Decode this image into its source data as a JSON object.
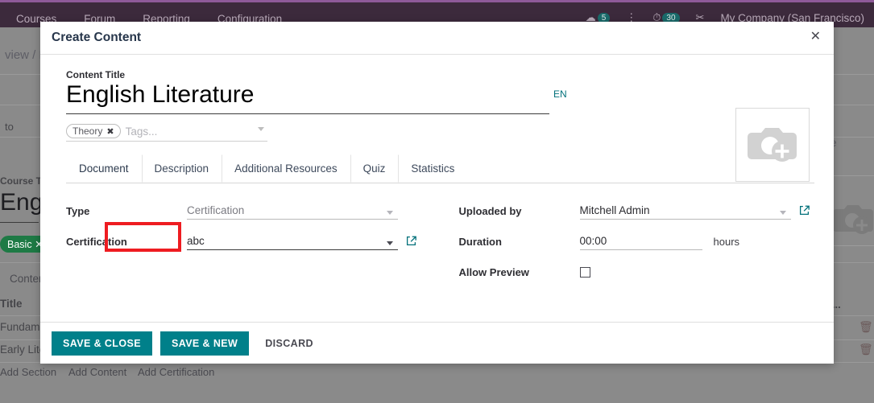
{
  "background": {
    "topnav": {
      "items": [
        "Courses",
        "Forum",
        "Reporting",
        "Configuration"
      ],
      "badges": [
        {
          "icon": "message-icon",
          "count": "5"
        },
        {
          "icon": "clock-icon",
          "count": "30"
        }
      ],
      "activity_icon": "activities-icon",
      "scissors_icon": "scissors-icon",
      "company": "My Company (San Francisco)"
    },
    "breadcrumb": "view / N",
    "go_to_website": {
      "line1": "to",
      "line2": "osite"
    },
    "course_title_label": "Course Ti",
    "course_title_value": "Engl",
    "tag_pill": "Basic",
    "tag_pill_close": "✕",
    "content_label": "Content",
    "column_title": "Title",
    "rows": [
      "Fundame",
      "Early Lite"
    ],
    "footer_links": [
      "Add Section",
      "Add Content",
      "Add Certification"
    ],
    "right_snippet": "is...",
    "camera_icon": "camera-add-icon",
    "trash_icon": "trash-icon"
  },
  "modal": {
    "title": "Create Content",
    "close_label": "✕",
    "content_title": {
      "label": "Content Title",
      "value": "English Literature",
      "lang": "EN"
    },
    "tags": {
      "selected": [
        {
          "label": "Theory",
          "remove": "✖"
        }
      ],
      "placeholder": "Tags...",
      "caret_icon": "chevron-down-icon"
    },
    "tabs": [
      {
        "id": "document",
        "label": "Document",
        "active": true
      },
      {
        "id": "description",
        "label": "Description",
        "active": false
      },
      {
        "id": "additional-resources",
        "label": "Additional Resources",
        "active": false
      },
      {
        "id": "quiz",
        "label": "Quiz",
        "active": false
      },
      {
        "id": "statistics",
        "label": "Statistics",
        "active": false
      }
    ],
    "fields_left": [
      {
        "name": "type",
        "label": "Type",
        "value": "Certification",
        "placeholder": "",
        "dim": true,
        "has_caret": true,
        "has_external_link": false
      },
      {
        "name": "certification",
        "label": "Certification",
        "value": "abc",
        "placeholder": "",
        "dim": false,
        "has_caret": true,
        "has_external_link": true
      }
    ],
    "fields_right": [
      {
        "name": "uploaded-by",
        "label": "Uploaded by",
        "value": "Mitchell Admin",
        "placeholder": "",
        "dim": false,
        "has_caret": true,
        "has_external_link": true
      },
      {
        "name": "duration",
        "label": "Duration",
        "value": "00:00",
        "placeholder": "",
        "unit": "hours",
        "dim": false,
        "has_caret": false,
        "has_external_link": false
      },
      {
        "name": "allow-preview",
        "label": "Allow Preview",
        "type": "checkbox",
        "checked": false
      }
    ],
    "image_placeholder_icon": "camera-add-icon",
    "footer": {
      "save_close": "SAVE & CLOSE",
      "save_new": "SAVE & NEW",
      "discard": "DISCARD"
    }
  },
  "colors": {
    "primary": "#00808a",
    "highlight": "#ee1c21",
    "topbar": "#3c2a3c",
    "link": "#00707a"
  }
}
